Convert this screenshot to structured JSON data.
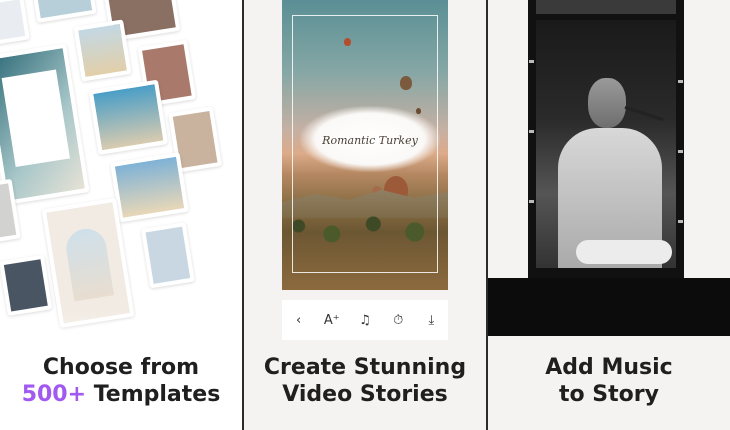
{
  "panel1": {
    "caption_line1": "Choose from",
    "caption_accent": "500+",
    "caption_rest": " Templates",
    "accent_color": "#a259f0"
  },
  "panel2": {
    "story_text": "Romantic Turkey",
    "toolbar": [
      {
        "icon": "back-chevron-icon",
        "glyph": "‹"
      },
      {
        "icon": "text-add-icon",
        "glyph": "A⁺"
      },
      {
        "icon": "music-note-icon",
        "glyph": "♫"
      },
      {
        "icon": "timer-icon",
        "glyph": "⏱"
      },
      {
        "icon": "download-icon",
        "glyph": "⤓"
      }
    ],
    "caption_line1": "Create Stunning",
    "caption_line2": "Video Stories"
  },
  "panel3": {
    "caption_line1": "Add Music",
    "caption_line2": "to Story"
  }
}
